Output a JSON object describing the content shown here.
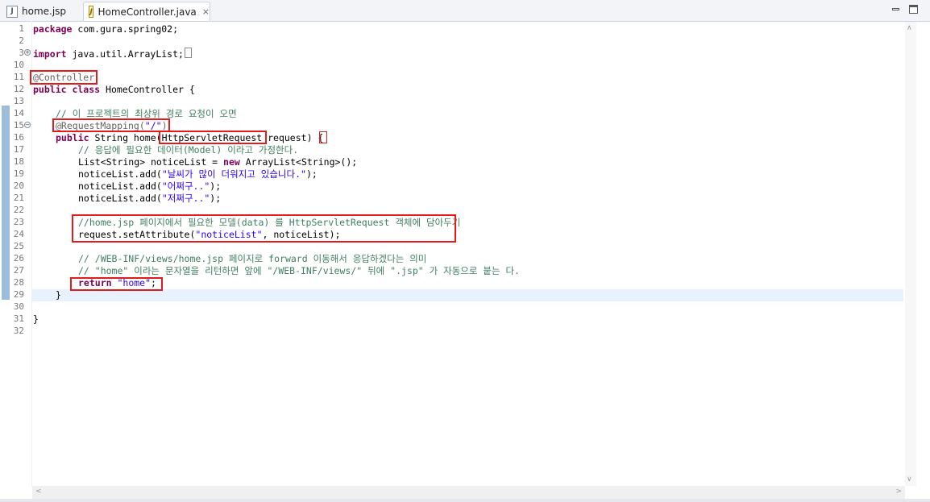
{
  "tabs": [
    {
      "label": "home.jsp",
      "icon": "jsp-file-icon",
      "active": false
    },
    {
      "label": "HomeController.java",
      "icon": "java-file-icon",
      "active": true
    }
  ],
  "editor": {
    "close_glyph": "⨯",
    "line_numbers": [
      "1",
      "2",
      "3",
      "10",
      "11",
      "12",
      "13",
      "14",
      "15",
      "16",
      "17",
      "18",
      "19",
      "20",
      "21",
      "22",
      "23",
      "24",
      "25",
      "26",
      "27",
      "28",
      "29",
      "30",
      "31",
      "32"
    ],
    "code": {
      "l1_kw": "package",
      "l1_rest": " com.gura.spring02;",
      "l3_kw": "import",
      "l3_rest": " java.util.ArrayList;",
      "l11_ann": "@Controller",
      "l12_kw": "public class",
      "l12_rest": " HomeController {",
      "l14_cmt": "// 이 프로젝트의 최상위 경로 요청이 오면",
      "l15_ann": "@RequestMapping(",
      "l15_str": "\"/\"",
      "l15_close": ")",
      "l16_kw": "public",
      "l16_a": " String home(",
      "l16_type": "HttpServletRequest",
      "l16_b": " request) {",
      "l17_cmt": "// 응답에 필요한 데이터(Model) 이라고 가정한다.",
      "l18_a": "List<String> noticeList = ",
      "l18_kw": "new",
      "l18_b": " ArrayList<String>();",
      "l19_a": "noticeList.add(",
      "l19_str": "\"날씨가 많이 더워지고 있습니다.\"",
      "l19_b": ");",
      "l20_a": "noticeList.add(",
      "l20_str": "\"어쩌구..\"",
      "l20_b": ");",
      "l21_a": "noticeList.add(",
      "l21_str": "\"저쩌구..\"",
      "l21_b": ");",
      "l23_cmt": "//home.jsp 페이지에서 필요한 모델(data) 를 HttpServletRequest 객체에 담아두기",
      "l24_a": "request.setAttribute(",
      "l24_str": "\"noticeList\"",
      "l24_b": ", noticeList);",
      "l26_cmt": "// /WEB-INF/views/home.jsp 페이지로 forward 이동해서 응답하겠다는 의미",
      "l27_cmt": "// \"home\" 이라는 문자열을 리턴하면 앞에 \"/WEB-INF/views/\" 뒤에 \".jsp\" 가 자동으로 붙는 다.",
      "l28_kw": "return",
      "l28_str": "\"home\"",
      "l28_b": ";",
      "l29": "}",
      "l31": "}"
    }
  },
  "colors": {
    "keyword": "#7f0055",
    "string": "#2a00ff",
    "comment": "#3f7f5f",
    "annotation": "#646464",
    "highlight_box": "#e41b1b",
    "current_line": "#e8f2fe"
  }
}
